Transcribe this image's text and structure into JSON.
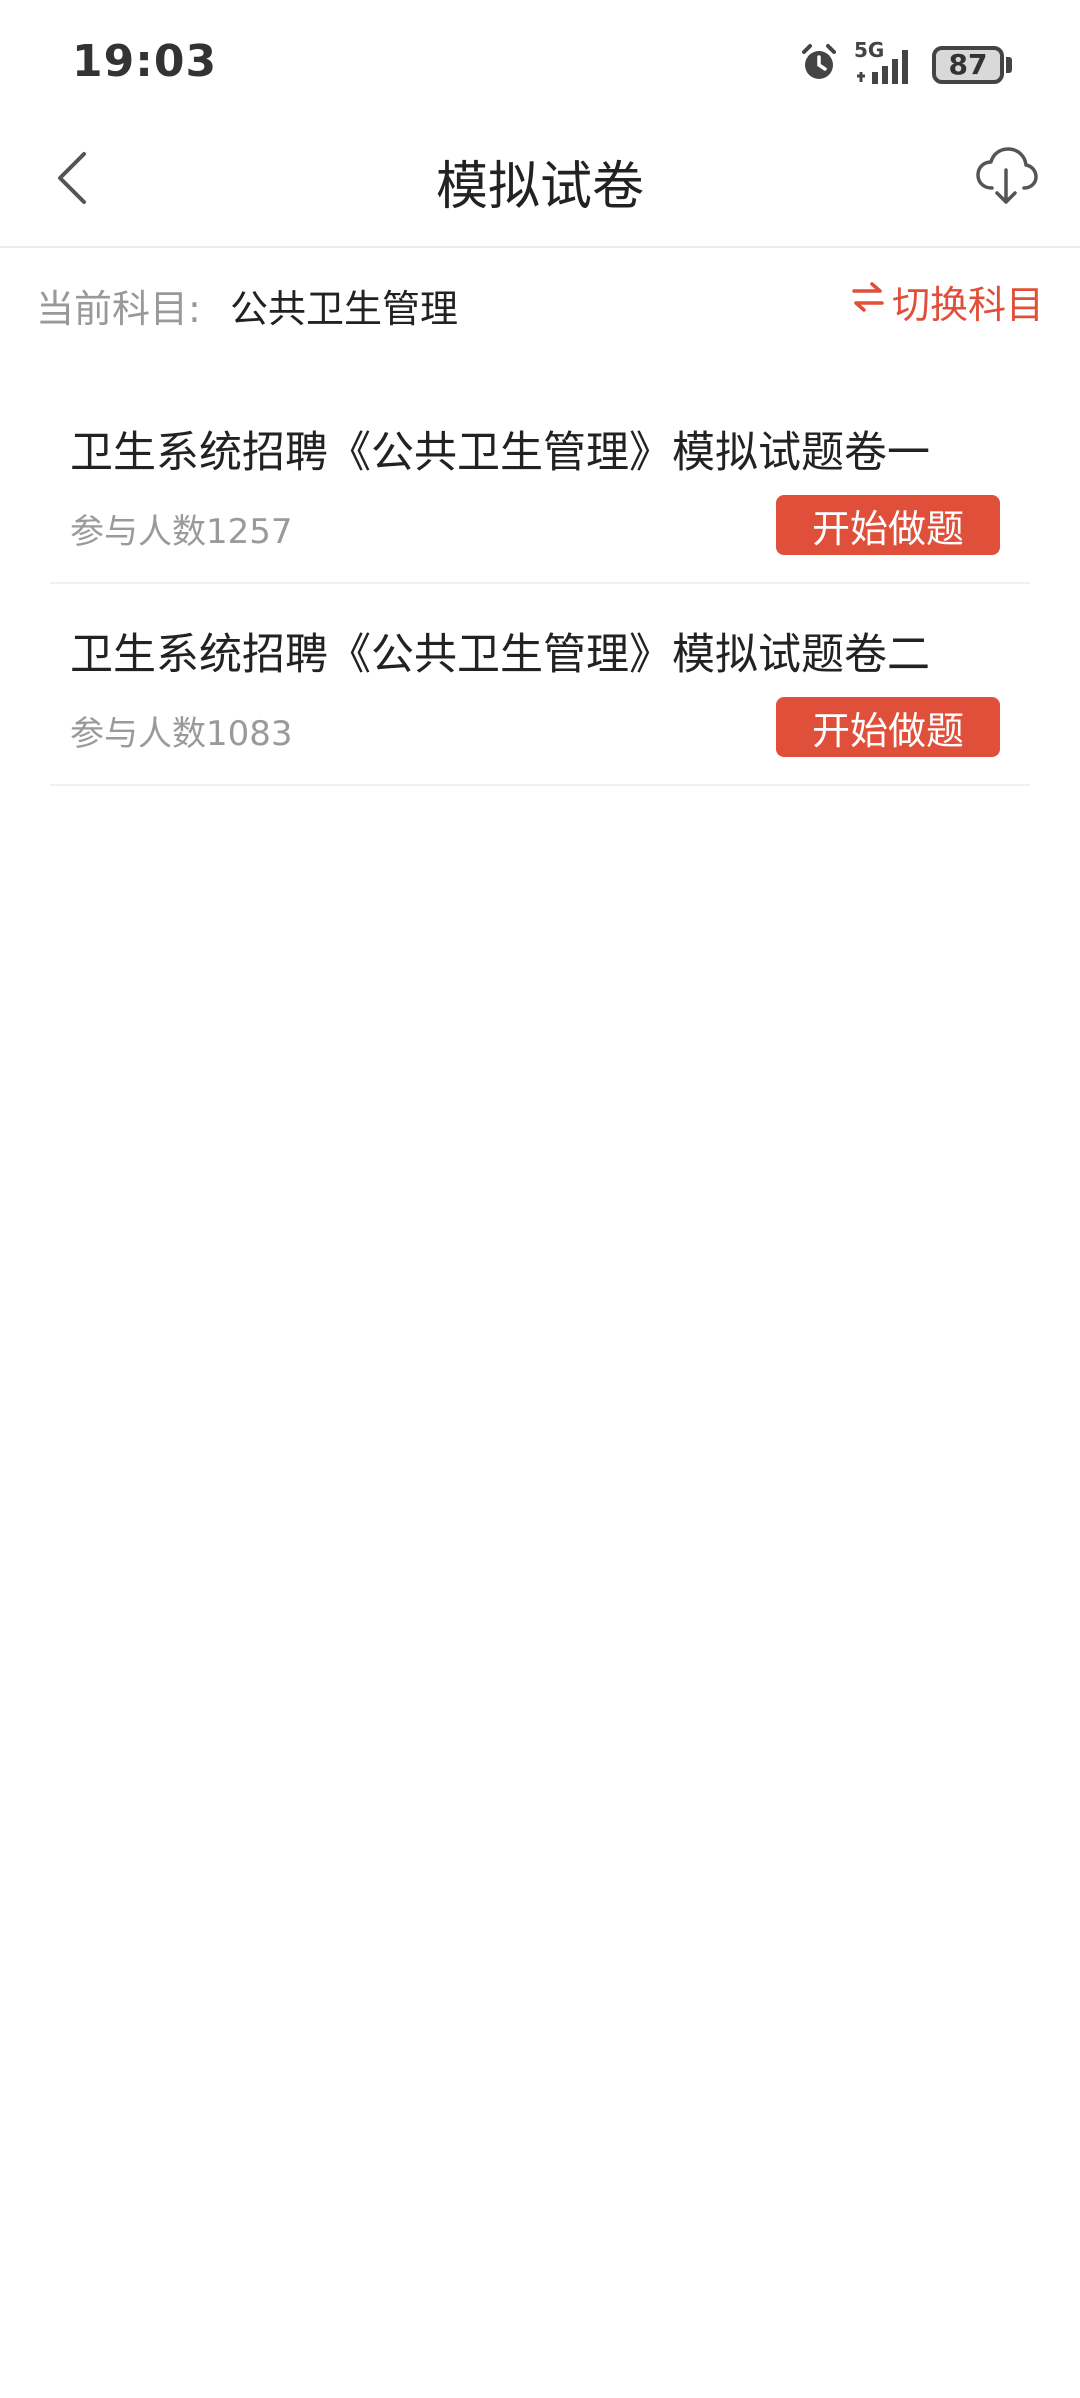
{
  "status_bar": {
    "time": "19:03",
    "network": "5G",
    "battery": "87",
    "icons": [
      "alarm-icon",
      "signal-icon",
      "battery-icon"
    ]
  },
  "header": {
    "title": "模拟试卷",
    "back_icon": "chevron-left-icon",
    "download_icon": "cloud-download-icon"
  },
  "subject": {
    "label": "当前科目:",
    "value": "公共卫生管理",
    "switch_label": "切换科目",
    "switch_icon": "swap-arrows-icon"
  },
  "papers": [
    {
      "title": "卫生系统招聘《公共卫生管理》模拟试题卷一",
      "participants": "参与人数1257",
      "button": "开始做题"
    },
    {
      "title": "卫生系统招聘《公共卫生管理》模拟试题卷二",
      "participants": "参与人数1083",
      "button": "开始做题"
    }
  ],
  "colors": {
    "accent": "#e04f3a",
    "muted_text": "#999999",
    "divider": "#f0f0f0"
  }
}
